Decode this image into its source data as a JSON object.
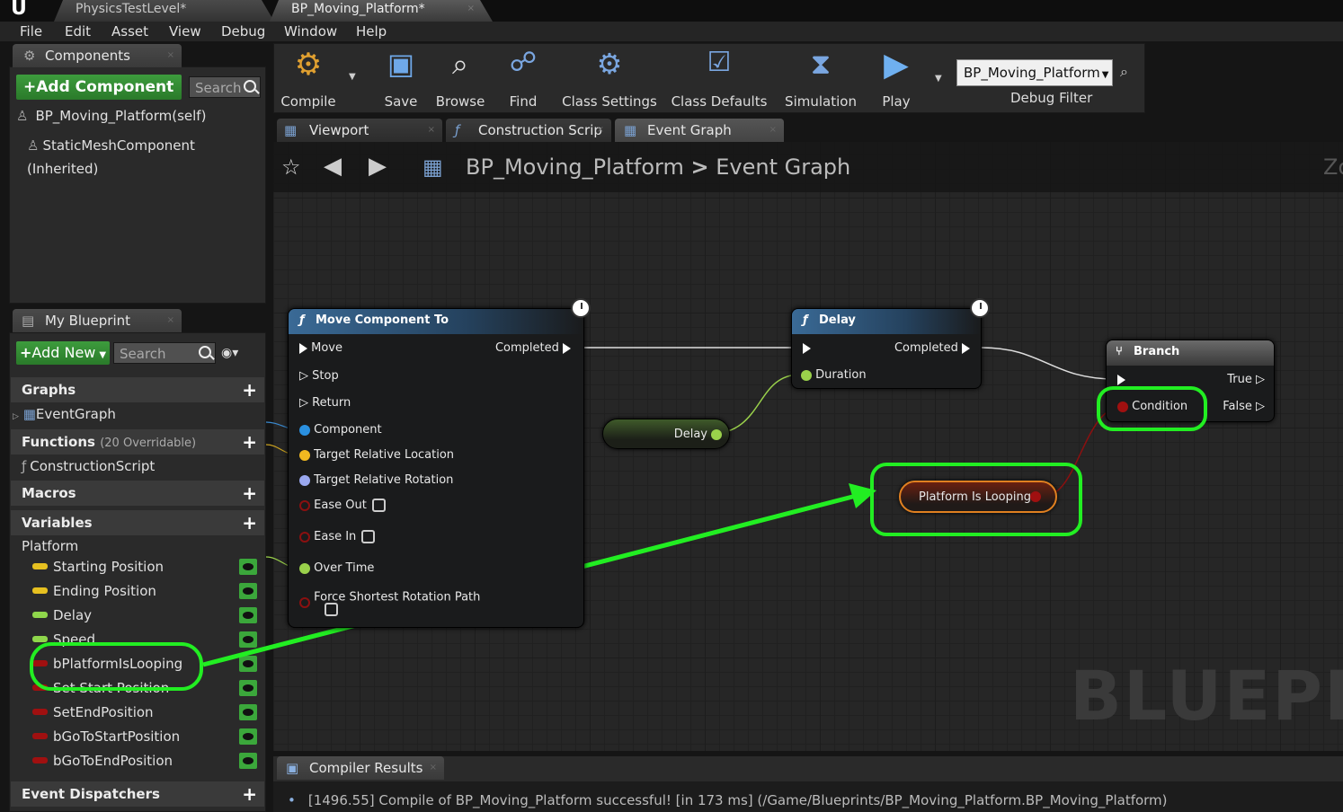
{
  "window_tabs": [
    {
      "label": "PhysicsTestLevel*"
    },
    {
      "label": "BP_Moving_Platform*"
    }
  ],
  "menu": [
    "File",
    "Edit",
    "Asset",
    "View",
    "Debug",
    "Window",
    "Help"
  ],
  "components": {
    "tab": "Components",
    "add_label": "+Add Component",
    "search_placeholder": "Search",
    "items": [
      "BP_Moving_Platform(self)",
      "StaticMeshComponent (Inherited)"
    ]
  },
  "toolbar": {
    "buttons": [
      "Compile",
      "Save",
      "Browse",
      "Find",
      "Class Settings",
      "Class Defaults",
      "Simulation",
      "Play"
    ],
    "debug_object": "BP_Moving_Platform",
    "debug_filter_label": "Debug Filter"
  },
  "editor_tabs": [
    "Viewport",
    "Construction Scrip",
    "Event Graph"
  ],
  "breadcrumb": {
    "blueprint": "BP_Moving_Platform",
    "graph": "Event Graph",
    "sep": ">",
    "zoom_partial": "Zo"
  },
  "my_blueprint": {
    "tab": "My Blueprint",
    "add_label": "Add New",
    "search_placeholder": "Search",
    "graphs_label": "Graphs",
    "graph_items": [
      "EventGraph"
    ],
    "functions_label": "Functions",
    "functions_count": "(20 Overridable)",
    "function_items": [
      "ConstructionScript"
    ],
    "macros_label": "Macros",
    "variables_label": "Variables",
    "platform_label": "Platform",
    "variables": [
      {
        "name": "Starting Position",
        "color": "#e6c020"
      },
      {
        "name": "Ending Position",
        "color": "#e6c020"
      },
      {
        "name": "Delay",
        "color": "#8fd64b"
      },
      {
        "name": "Speed",
        "color": "#8fd64b"
      },
      {
        "name": "bPlatformIsLooping",
        "color": "#a01010"
      },
      {
        "name": "Set Start Position",
        "color": "#a01010"
      },
      {
        "name": "SetEndPosition",
        "color": "#a01010"
      },
      {
        "name": "bGoToStartPosition",
        "color": "#a01010"
      },
      {
        "name": "bGoToEndPosition",
        "color": "#a01010"
      }
    ],
    "dispatchers_label": "Event Dispatchers"
  },
  "nodes": {
    "move": {
      "title": "Move Component To",
      "inputs": [
        "Move",
        "Stop",
        "Return",
        "Component",
        "Target Relative Location",
        "Target Relative Rotation",
        "Ease Out",
        "Ease In",
        "Over Time",
        "Force Shortest Rotation Path"
      ],
      "output": "Completed"
    },
    "delay": {
      "title": "Delay",
      "input": "Duration",
      "output": "Completed"
    },
    "branch": {
      "title": "Branch",
      "condition": "Condition",
      "true_label": "True",
      "false_label": "False"
    },
    "delay_var": {
      "label": "Delay"
    },
    "looping_var": {
      "label": "Platform Is Looping"
    }
  },
  "watermark": "BLUEPRIN",
  "compiler": {
    "tab": "Compiler Results",
    "message": "[1496.55] Compile of BP_Moving_Platform successful! [in 173 ms] (/Game/Blueprints/BP_Moving_Platform.BP_Moving_Platform)"
  }
}
